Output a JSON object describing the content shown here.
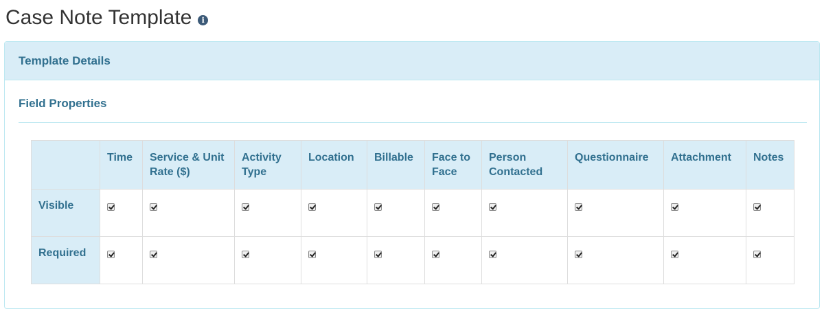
{
  "page": {
    "title": "Case Note Template",
    "info_icon": "info-circle-icon"
  },
  "panel": {
    "heading": "Template Details",
    "section_title": "Field Properties"
  },
  "colors": {
    "panel_heading_bg": "#d9edf7",
    "panel_border": "#bce8f1",
    "heading_text": "#31708f"
  },
  "table": {
    "columns": [
      "Time",
      "Service & Unit Rate ($)",
      "Activity Type",
      "Location",
      "Billable",
      "Face to Face",
      "Person Contacted",
      "Questionnaire",
      "Attachment",
      "Notes"
    ],
    "rows": [
      {
        "label": "Visible",
        "checked": [
          true,
          true,
          true,
          true,
          true,
          true,
          true,
          true,
          true,
          true
        ]
      },
      {
        "label": "Required",
        "checked": [
          true,
          true,
          true,
          true,
          true,
          true,
          true,
          true,
          true,
          true
        ]
      }
    ]
  }
}
